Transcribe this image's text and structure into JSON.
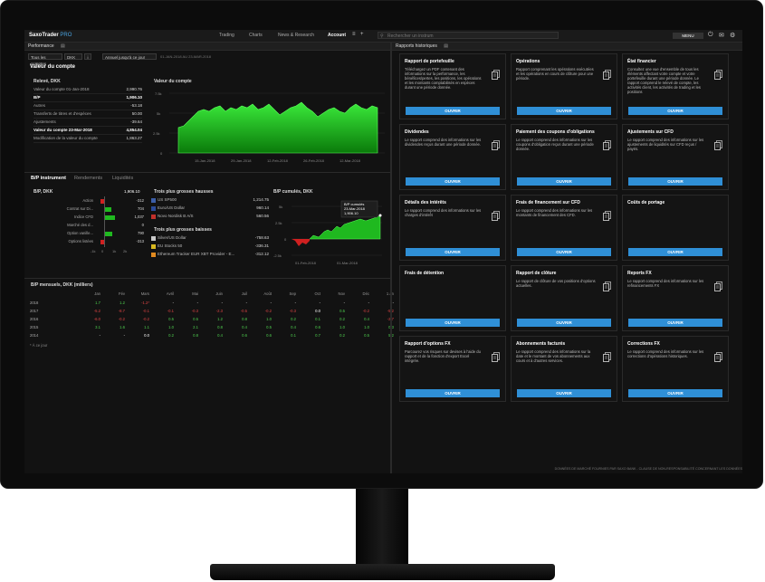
{
  "app": {
    "brand": "SaxoTrader",
    "brand_suffix": "PRO",
    "menu_label": "MENU"
  },
  "nav": {
    "tabs": [
      "Trading",
      "Charts",
      "News & Research",
      "Account"
    ],
    "active": "Account",
    "search_placeholder": "Rechercher un instrum"
  },
  "left": {
    "panel_title": "Performance",
    "filters": {
      "accounts": "Tous les comptes",
      "currency": "DKK",
      "period": "Annuel jusqu'à ce jour",
      "range": "01-JAN-2018 AU 23-MAR-2018"
    },
    "section_title": "Valeur du compte",
    "statement": {
      "title": "Relevé, DKK",
      "rows": [
        {
          "label": "Valeur du compte 01-Jan-2018",
          "value": "2,990.76",
          "bold": false
        },
        {
          "label": "B/P",
          "value": "1,906.10",
          "bold": true
        },
        {
          "label": "Autres",
          "value": "-53.18",
          "bold": false
        },
        {
          "label": "Transferts de titres et d'espèces",
          "value": "50.00",
          "bold": false
        },
        {
          "label": "Ajustements",
          "value": "-39.64",
          "bold": false
        },
        {
          "label": "Valeur du compte 23-Mar-2018",
          "value": "4,854.04",
          "bold": true
        },
        {
          "label": "Modification de la valeur du compte",
          "value": "1,863.27",
          "bold": false
        }
      ]
    },
    "account_chart": {
      "title": "Valeur du compte",
      "y_ticks": [
        "7.5k",
        "5k",
        "2.5k",
        "0"
      ],
      "x_ticks": [
        "15-Jan-2018",
        "29-Jan-2018",
        "12-Feb-2018",
        "26-Feb-2018",
        "12-Mar-2018"
      ]
    },
    "tabs": [
      "B/P instrument",
      "Rendements",
      "Liquidités"
    ],
    "bp_instrument": {
      "title": "B/P, DKK",
      "total": "1,906.10",
      "rows": [
        {
          "label": "Action",
          "value": "-312"
        },
        {
          "label": "Contrat sur Di...",
          "value": "704"
        },
        {
          "label": "Indice CFD",
          "value": "1,037"
        },
        {
          "label": "Marché des d...",
          "value": "0"
        },
        {
          "label": "Option vanille...",
          "value": "790"
        },
        {
          "label": "Options listées",
          "value": "-313"
        }
      ],
      "x_ticks": [
        "-1k",
        "0",
        "1k",
        "2k"
      ]
    },
    "gainers": {
      "title": "Trois plus grosses hausses",
      "rows": [
        {
          "name": "US SP500",
          "value": "1,214.75"
        },
        {
          "name": "Euro/US Dollar",
          "value": "960.14"
        },
        {
          "name": "Novo Nordisk B A/S",
          "value": "560.56"
        }
      ]
    },
    "losers": {
      "title": "Trois plus grosses baisses",
      "rows": [
        {
          "name": "Silver/US Dollar",
          "value": "-758.63"
        },
        {
          "name": "EU Stocks 50",
          "value": "-336.31"
        },
        {
          "name": "Ethereum Tracker EUR XBT Provider - E...",
          "value": "-312.12"
        }
      ]
    },
    "cumulative": {
      "title": "B/P cumulés, DKK",
      "tooltip_title": "B/P cumulés",
      "tooltip_date": "23-Mar-2018",
      "tooltip_value": "1,906.10",
      "y_ticks": [
        "5k",
        "2.5k",
        "0",
        "-2.5k"
      ],
      "x_ticks": [
        "01-Feb-2018",
        "01-Mar-2018"
      ]
    },
    "monthly": {
      "title": "B/P mensuels, DKK (milliers)",
      "months": [
        "Jan",
        "Fév",
        "Mars",
        "Avril",
        "Mai",
        "Juin",
        "Juil",
        "Août",
        "Sep",
        "Oct",
        "Nov",
        "Déc",
        "1 an"
      ],
      "rows": [
        {
          "year": "2018",
          "values": [
            "1.7",
            "1.2",
            "-1.2*",
            "-",
            "-",
            "-",
            "-",
            "-",
            "-",
            "-",
            "-",
            "-",
            "-"
          ]
        },
        {
          "year": "2017",
          "values": [
            "-5.2",
            "-8.7",
            "-0.1",
            "-0.1",
            "-0.3",
            "-2.3",
            "-0.5",
            "-0.2",
            "-0.3",
            "0.0",
            "0.5",
            "-0.2",
            "-5.2"
          ]
        },
        {
          "year": "2016",
          "values": [
            "-6.0",
            "-0.2",
            "-0.2",
            "0.5",
            "0.5",
            "1.2",
            "0.8",
            "1.0",
            "0.2",
            "0.1",
            "0.2",
            "0.4",
            "-2.7"
          ]
        },
        {
          "year": "2015",
          "values": [
            "3.1",
            "1.6",
            "1.1",
            "1.0",
            "2.1",
            "0.8",
            "0.4",
            "0.5",
            "0.4",
            "0.6",
            "1.0",
            "1.0",
            "0.3"
          ]
        },
        {
          "year": "2014",
          "values": [
            "-",
            "-",
            "0.0",
            "0.2",
            "0.8",
            "0.4",
            "0.6",
            "0.6",
            "0.1",
            "0.7",
            "0.2",
            "0.5",
            "5.2"
          ]
        }
      ],
      "footnote": "* À ce jour"
    }
  },
  "right": {
    "panel_title": "Rapports historiques",
    "button_label": "OUVRIR",
    "cards": [
      {
        "title": "Rapport de portefeuille",
        "desc": "Téléchargez un PDF contenant des informations sur la performance, les bénéfices/pertes, les positions, les opérations et les montants comptabilisés en espèces durant une période donnée.",
        "button": true
      },
      {
        "title": "Opérations",
        "desc": "Rapport comprenant les opérations exécutées et les opérations en cours de clôture pour une période.",
        "button": true
      },
      {
        "title": "État financier",
        "desc": "Consultez une vue d'ensemble de tous les éléments affectant votre compte et votre portefeuille durant une période donnée. Le rapport comprend le relevé de compte, les activités client, les activités de trading et les positions",
        "button": true
      },
      {
        "title": "Dividendes",
        "desc": "Le rapport comprend des informations sur les dividendes reçus durant une période donnée.",
        "button": true
      },
      {
        "title": "Paiement des coupons d'obligations",
        "desc": "Le rapport comprend des informations sur les coupons d'obligation reçus durant une période donnée.",
        "button": true
      },
      {
        "title": "Ajustements sur CFD",
        "desc": "Le rapport comprend des informations sur les ajustements de liquidités sur CFD reçus / payés.",
        "button": true
      },
      {
        "title": "Détails des intérêts",
        "desc": "Le rapport comprend des informations sur les charges d'intérêt",
        "button": true
      },
      {
        "title": "Frais de financement sur CFD",
        "desc": "Le rapport comprend des informations sur les montants de financement des CFD.",
        "button": true
      },
      {
        "title": "Coûts de portage",
        "desc": "",
        "button": true
      },
      {
        "title": "Frais de détention",
        "desc": "",
        "button": true
      },
      {
        "title": "Rapport de clôture",
        "desc": "Le rapport de clôture de vos positions d'options actuelles.",
        "button": true
      },
      {
        "title": "Reports FX",
        "desc": "Le rapport comprend des informations sur les refinancements FX",
        "button": true
      },
      {
        "title": "Rapport d'options FX",
        "desc": "Parcourez vos risques sur devises à l'aide du rapport et de la fonction d'export Excel intégrée.",
        "button": true
      },
      {
        "title": "Abonnements facturés",
        "desc": "Le rapport comprend des informations sur la date et le montant de vos abonnements aux cours et à d'autres services.",
        "button": true
      },
      {
        "title": "Corrections FX",
        "desc": "Le rapport comprend des informations sur les corrections d'opérations historiques.",
        "button": true
      }
    ],
    "footer": "DONNÉES DE MARCHÉ FOURNIES PAR SAXO BANK - CLAUSE DE NON-RESPONSABILITÉ CONCERNANT LES DONNÉES"
  },
  "colors": {
    "accent": "#2f8fd6",
    "positive": "#4fd04f",
    "negative": "#e04545",
    "chart_green": "#1fd11f"
  }
}
